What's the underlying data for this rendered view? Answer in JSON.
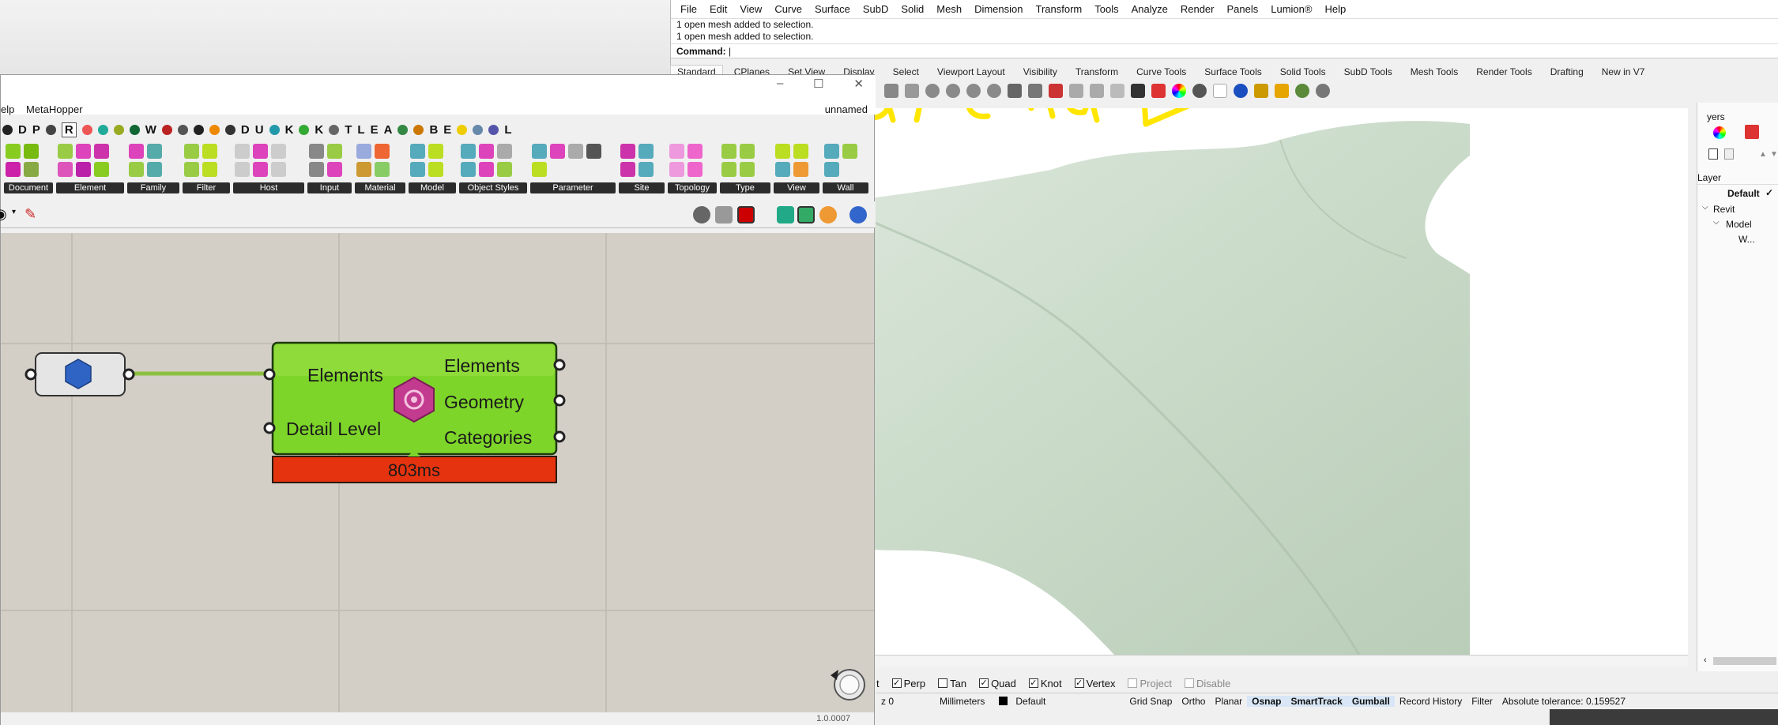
{
  "rhino": {
    "menu": [
      "File",
      "Edit",
      "View",
      "Curve",
      "Surface",
      "SubD",
      "Solid",
      "Mesh",
      "Dimension",
      "Transform",
      "Tools",
      "Analyze",
      "Render",
      "Panels",
      "Lumion®",
      "Help"
    ],
    "history": [
      "1 open mesh added to selection.",
      "1 open mesh added to selection."
    ],
    "command_label": "Command:",
    "toolbar_tabs": [
      "Standard",
      "CPlanes",
      "Set View",
      "Display",
      "Select",
      "Viewport Layout",
      "Visibility",
      "Transform",
      "Curve Tools",
      "Surface Tools",
      "Solid Tools",
      "SubD Tools",
      "Mesh Tools",
      "Render Tools",
      "Drafting",
      "New in V7"
    ],
    "annotation": {
      "text1": "Lost",
      "text2": "Material",
      "color": "#ffe600"
    },
    "surface_color": "#d0ddd0",
    "osnaps": [
      {
        "label": "Perp",
        "checked": true
      },
      {
        "label": "Tan",
        "checked": false
      },
      {
        "label": "Quad",
        "checked": true
      },
      {
        "label": "Knot",
        "checked": true
      },
      {
        "label": "Vertex",
        "checked": true
      },
      {
        "label": "Project",
        "checked": false
      },
      {
        "label": "Disable",
        "checked": false
      }
    ],
    "osnap_partial": "t",
    "status": {
      "z": "z 0",
      "units": "Millimeters",
      "layer": "Default",
      "items": [
        "Grid Snap",
        "Ortho",
        "Planar",
        "Osnap",
        "SmartTrack",
        "Gumball",
        "Record History",
        "Filter"
      ],
      "tolerance": "Absolute tolerance: 0.159527"
    },
    "layers": {
      "title": "yers",
      "column": "Layer",
      "default": "Default",
      "revit": "Revit",
      "model": "Model",
      "wall": "W..."
    }
  },
  "gh": {
    "menu_partial": "elp",
    "menu_meta": "MetaHopper",
    "doc_name": "unnamed",
    "letters": [
      "D",
      "P",
      "R",
      "W",
      "D",
      "U",
      "K",
      "K",
      "T",
      "L",
      "E",
      "A",
      "B",
      "E",
      "L"
    ],
    "groups": [
      "Document",
      "Element",
      "Family",
      "Filter",
      "Host",
      "Input",
      "Material",
      "Model",
      "Object Styles",
      "Parameter",
      "Site",
      "Topology",
      "Type",
      "View",
      "Wall"
    ],
    "component": {
      "inputs": [
        "Elements",
        "Detail Level"
      ],
      "outputs": [
        "Elements",
        "Geometry",
        "Categories"
      ],
      "time": "803ms"
    },
    "version": "1.0.0007"
  }
}
